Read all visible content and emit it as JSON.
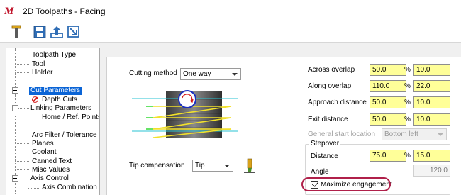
{
  "window": {
    "logo_text": "M",
    "title": "2D Toolpaths - Facing"
  },
  "toolbar": {
    "icons": [
      "tool-icon",
      "save-icon",
      "upload-icon",
      "export-icon"
    ]
  },
  "tree": {
    "items": [
      {
        "label": "Toolpath Type"
      },
      {
        "label": "Tool"
      },
      {
        "label": "Holder"
      },
      {
        "label": "Cut Parameters",
        "selected": true
      },
      {
        "label": "Depth Cuts"
      },
      {
        "label": "Linking Parameters"
      },
      {
        "label": "Home / Ref. Points"
      },
      {
        "label": "Arc Filter / Tolerance"
      },
      {
        "label": "Planes"
      },
      {
        "label": "Coolant"
      },
      {
        "label": "Canned Text"
      },
      {
        "label": "Misc Values"
      },
      {
        "label": "Axis Control"
      },
      {
        "label": "Axis Combination"
      }
    ]
  },
  "cut": {
    "cutting_method_label": "Cutting method",
    "cutting_method_value": "One way",
    "tip_comp_label": "Tip compensation",
    "tip_comp_value": "Tip"
  },
  "params": {
    "across_overlap": {
      "label": "Across overlap",
      "value": "50.0",
      "unit": "%",
      "pct": "10.0"
    },
    "along_overlap": {
      "label": "Along overlap",
      "value": "110.0",
      "unit": "%",
      "pct": "22.0"
    },
    "approach_distance": {
      "label": "Approach distance",
      "value": "50.0",
      "unit": "%",
      "pct": "10.0"
    },
    "exit_distance": {
      "label": "Exit distance",
      "value": "50.0",
      "unit": "%",
      "pct": "10.0"
    },
    "general_start_location": {
      "label": "General start location",
      "value": "Bottom left"
    }
  },
  "stepover": {
    "title": "Stepover",
    "distance_label": "Distance",
    "distance_value": "75.0",
    "unit": "%",
    "distance_pct": "15.0",
    "angle_label": "Angle",
    "angle_value": "120.0",
    "maximize_label": "Maximize engagement",
    "maximize_checked": true
  },
  "colors": {
    "accent_select": "#0a64d6",
    "input_yellow": "#ffff99",
    "highlight": "#b0204a",
    "logo": "#c0162c"
  }
}
